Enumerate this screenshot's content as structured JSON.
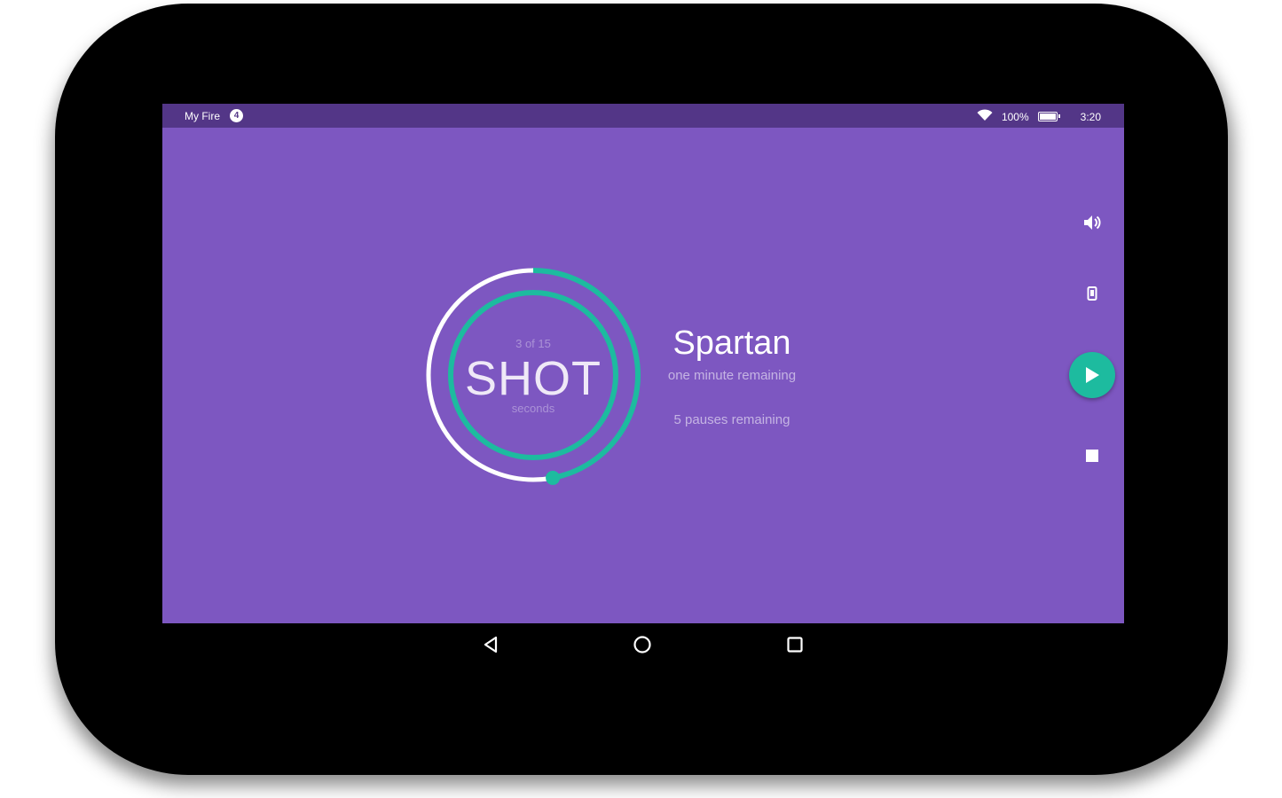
{
  "statusbar": {
    "device_name": "My Fire",
    "notification_count": "4",
    "battery_level": "100%",
    "time": "3:20"
  },
  "timer": {
    "round_label": "3 of 15",
    "exercise_label": "SHOT",
    "unit_label": "seconds",
    "outer_progress_fraction": 0.47,
    "inner_progress_fraction": 1.0
  },
  "workout": {
    "name": "Spartan",
    "time_remaining": "one minute remaining",
    "pauses_remaining": "5 pauses remaining"
  },
  "controls": {
    "sound_icon": "volume-icon",
    "phone_icon": "vibrate-icon",
    "play_icon": "play-icon",
    "stop_icon": "stop-icon"
  },
  "navbar": {
    "back_icon": "back-triangle-icon",
    "home_icon": "home-circle-icon",
    "recents_icon": "recents-square-icon"
  },
  "colors": {
    "screen_bg": "#7d57c1",
    "statusbar_bg": "#533687",
    "accent": "#1dbb9f",
    "bezel": "#000000"
  }
}
